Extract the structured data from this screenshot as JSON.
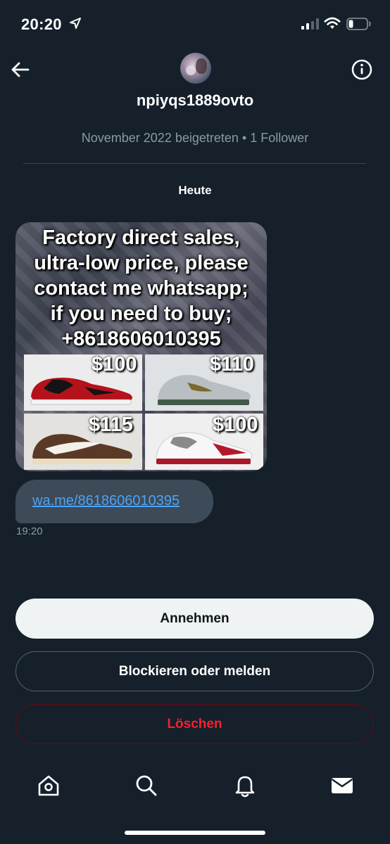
{
  "status_bar": {
    "time": "20:20"
  },
  "header": {
    "username": "npiyqs1889ovto",
    "meta": "November 2022 beigetreten • 1 Follower"
  },
  "conversation": {
    "date_label": "Heute",
    "image_message": {
      "promo_lines": [
        "Factory direct sales,",
        "ultra-low price, please",
        "contact me whatsapp;",
        "if you need to buy;",
        "+8618606010395"
      ],
      "prices": [
        "$100",
        "$110",
        "$115",
        "$100"
      ]
    },
    "link_message": {
      "text": "wa.me/8618606010395"
    },
    "timestamp": "19:20"
  },
  "actions": {
    "accept_label": "Annehmen",
    "block_label": "Blockieren oder melden",
    "delete_label": "Löschen"
  },
  "tab_bar": {
    "icons": [
      "home-icon",
      "search-icon",
      "bell-icon",
      "mail-icon"
    ]
  },
  "colors": {
    "background": "#15202b",
    "link": "#4da3f5",
    "delete": "#f4212e",
    "muted": "#8b98a5"
  }
}
